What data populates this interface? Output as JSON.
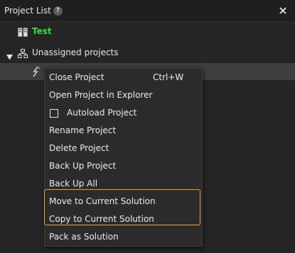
{
  "panel": {
    "title": "Project List",
    "help_icon": "?"
  },
  "tree": {
    "solution_name": "Test",
    "group_label": "Unassigned projects"
  },
  "context_menu": {
    "items": [
      {
        "label": "Close Project",
        "shortcut": "Ctrl+W"
      },
      {
        "label": "Open Project in Explorer"
      },
      {
        "label": "Autoload Project",
        "checkbox": true,
        "checked": false
      },
      {
        "label": "Rename Project"
      },
      {
        "label": "Delete Project"
      },
      {
        "label": "Back Up Project"
      },
      {
        "label": "Back Up All"
      },
      {
        "label": "Move to Current Solution"
      },
      {
        "label": "Copy to Current Solution"
      },
      {
        "label": "Pack as Solution"
      }
    ]
  },
  "colors": {
    "accent_highlight": "#f0a330",
    "solution_name": "#32e03a"
  }
}
